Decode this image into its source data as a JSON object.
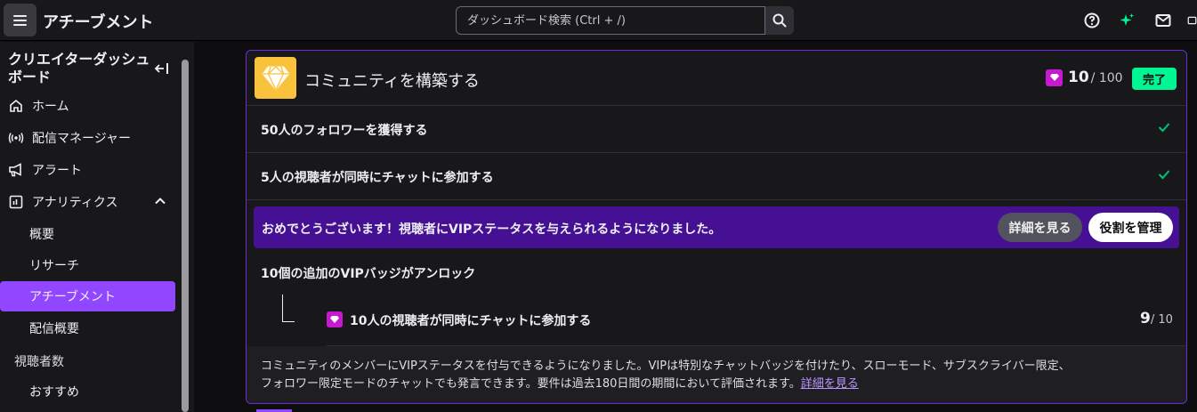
{
  "header": {
    "menu_icon": "hamburger-icon",
    "title": "アチーブメント",
    "search_placeholder": "ダッシュボード検索 (Ctrl + /)",
    "icons": [
      "help-icon",
      "sparkle-icon",
      "mail-icon",
      "window-icon"
    ]
  },
  "sidebar": {
    "title": "クリエイターダッシュボード",
    "items": [
      {
        "label": "ホーム",
        "icon": "home-icon"
      },
      {
        "label": "配信マネージャー",
        "icon": "broadcast-icon"
      },
      {
        "label": "アラート",
        "icon": "megaphone-icon"
      },
      {
        "label": "アナリティクス",
        "icon": "analytics-icon"
      }
    ],
    "analytics_sub": [
      "概要",
      "リサーチ",
      "アチーブメント",
      "配信概要"
    ],
    "category": "視聴者数",
    "category_items": [
      "おすすめ"
    ]
  },
  "card": {
    "title": "コミュニティを構築する",
    "points": "10",
    "points_total": "/ 100",
    "status": "完了",
    "tasks": [
      "50人のフォロワーを獲得する",
      "5人の視聴者が同時にチャットに参加する"
    ],
    "banner": {
      "message": "おめでとうございます！視聴者にVIPステータスを与えられるようになりました。",
      "details_label": "詳細を見る",
      "roles_label": "役割を管理"
    },
    "unlock_title": "10個の追加のVIPバッジがアンロック",
    "sub_task": {
      "label": "10人の視聴者が同時にチャットに参加する",
      "progress": "9",
      "total": "/ 10"
    },
    "footer_line1": "コミュニティのメンバーにVIPステータスを付与できるようになりました。VIPは特別なチャットバッジを付けたり、スローモード、サブスクライバー限定、",
    "footer_line2": "フォロワー限定モードのチャットでも発言できます。要件は過去180日間の期間において評価されます。",
    "footer_link": "詳細を見る"
  },
  "colors": {
    "accent": "#9147ff",
    "banner": "#451093",
    "success": "#00f593",
    "gem": "#c51ad0",
    "gold": "#f9c23c"
  }
}
